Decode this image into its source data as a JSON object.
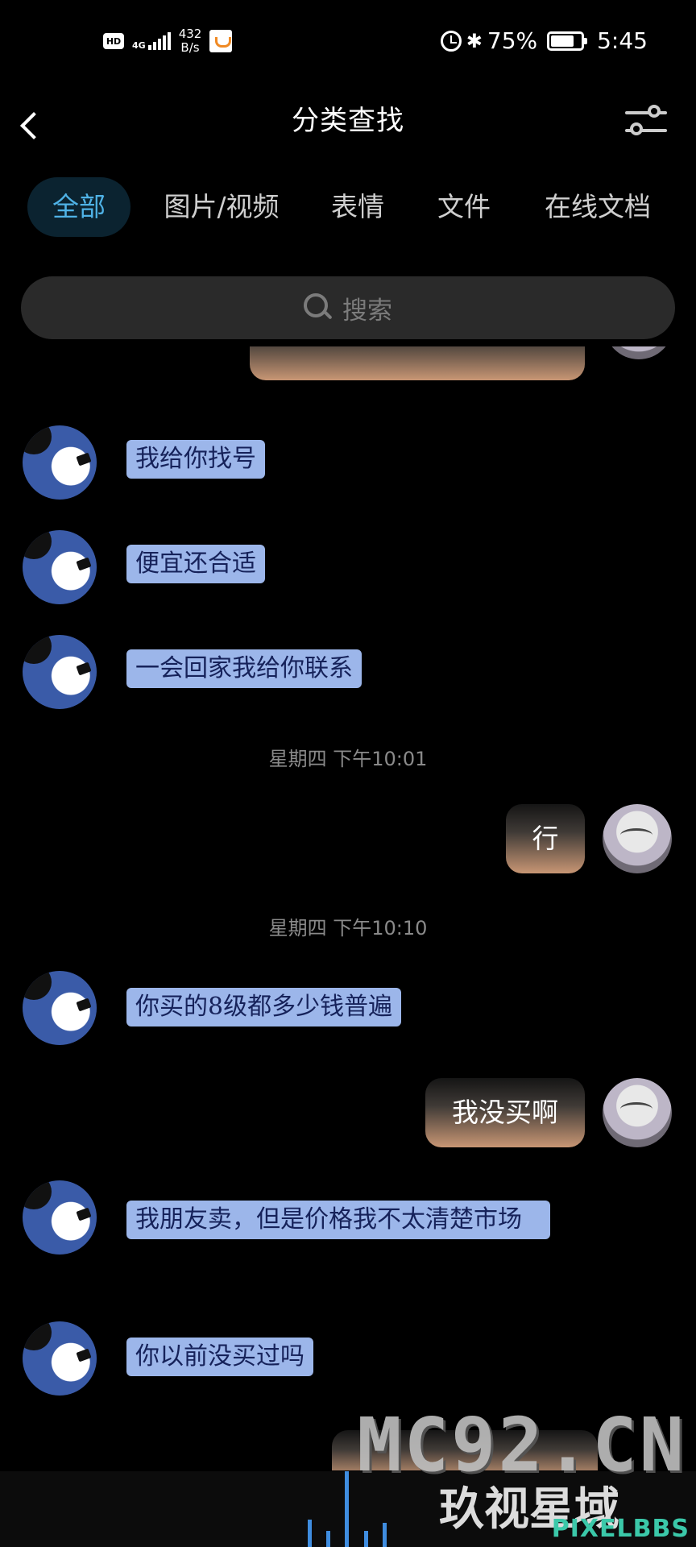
{
  "status_bar": {
    "hd": "HD",
    "network": "4G",
    "net_speed_value": "432",
    "net_speed_unit": "B/s",
    "battery": "75%",
    "time": "5:45",
    "icons": [
      "hd-icon",
      "signal-icon",
      "didi-app-icon",
      "alarm-icon",
      "bluetooth-icon",
      "battery-icon"
    ]
  },
  "header": {
    "title": "分类查找",
    "back_icon": "chevron-left-icon",
    "filter_icon": "sliders-icon"
  },
  "tabs": [
    {
      "label": "全部",
      "active": true
    },
    {
      "label": "图片/视频",
      "active": false
    },
    {
      "label": "表情",
      "active": false
    },
    {
      "label": "文件",
      "active": false
    },
    {
      "label": "在线文档",
      "active": false
    }
  ],
  "search": {
    "placeholder": "搜索"
  },
  "messages": [
    {
      "side": "left",
      "text": "我给你找号"
    },
    {
      "side": "left",
      "text": "便宜还合适"
    },
    {
      "side": "left",
      "text": "一会回家我给你联系"
    },
    {
      "type": "time",
      "text": "星期四 下午10:01"
    },
    {
      "side": "right",
      "text": "行"
    },
    {
      "type": "time",
      "text": "星期四 下午10:10"
    },
    {
      "side": "left",
      "text": "你买的8级都多少钱普遍"
    },
    {
      "side": "right",
      "text": "我没买啊"
    },
    {
      "side": "left",
      "text": "我朋友卖，但是价格我不太清楚市场"
    },
    {
      "side": "left",
      "text": "你以前没买过吗"
    }
  ],
  "watermark": {
    "logo": "MC92.CN",
    "cn": "玖视星域",
    "pb": "PIXELBBS"
  },
  "colors": {
    "accent_tab": "#4fb2e6",
    "left_bubble": "#9cb6ea",
    "background": "#000000"
  }
}
